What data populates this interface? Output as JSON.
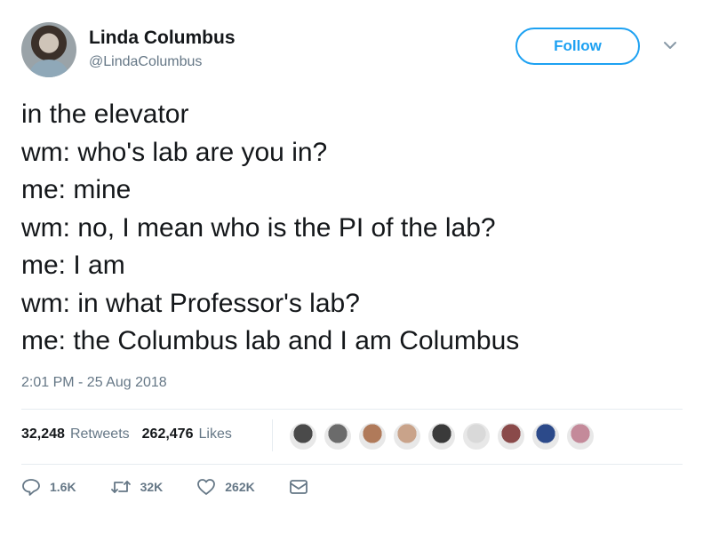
{
  "author": {
    "name": "Linda Columbus",
    "handle": "@LindaColumbus"
  },
  "follow_label": "Follow",
  "tweet_lines": [
    "in the elevator",
    "wm: who's lab are you in?",
    "me: mine",
    "wm: no, I mean who is the PI of the lab?",
    "me: I am",
    "wm: in what Professor's lab?",
    "me: the Columbus lab and I am Columbus"
  ],
  "timestamp": "2:01 PM - 25 Aug 2018",
  "stats": {
    "retweets_count": "32,248",
    "retweets_label": "Retweets",
    "likes_count": "262,476",
    "likes_label": "Likes"
  },
  "liker_avatar_colors": [
    "#4a4a4a",
    "#6b6b6b",
    "#b07a5a",
    "#c9a38a",
    "#3a3a3a",
    "#d9d9d9",
    "#8a4a4a",
    "#2c4a8a",
    "#c48a9a"
  ],
  "actions": {
    "reply_count": "1.6K",
    "retweet_count": "32K",
    "like_count": "262K"
  },
  "colors": {
    "accent": "#1da1f2",
    "text": "#14171a",
    "secondary_text": "#657786"
  }
}
